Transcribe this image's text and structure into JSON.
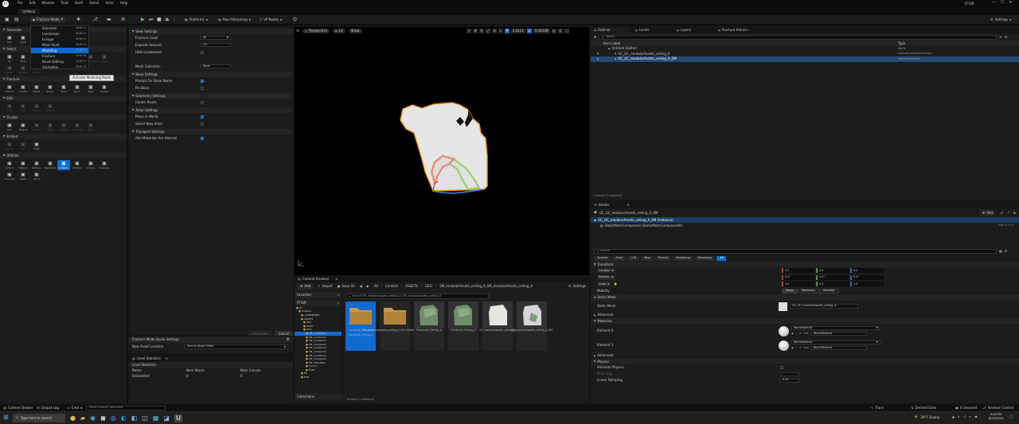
{
  "app": {
    "title": "UnMech",
    "project_name": "FFGIR",
    "menu": [
      "File",
      "Edit",
      "Window",
      "Tools",
      "Build",
      "Select",
      "Actor",
      "Help"
    ]
  },
  "toolbar": {
    "mode_label": "Fracture Mode",
    "platforms": "Platforms",
    "pixel_streaming": "Pixel Streaming",
    "vp_nodes": "VP Nodes",
    "settings": "Settings"
  },
  "mode_menu": {
    "items": [
      {
        "label": "Selection",
        "shortcut": "Shift+1"
      },
      {
        "label": "Landscape",
        "shortcut": "Shift+2"
      },
      {
        "label": "Foliage",
        "shortcut": "Shift+3"
      },
      {
        "label": "Mesh Paint",
        "shortcut": "Shift+4"
      },
      {
        "label": "Modeling",
        "shortcut": "Shift+5"
      },
      {
        "label": "Fracture",
        "shortcut": "Shift+6"
      },
      {
        "label": "Brush Editing",
        "shortcut": "Shift+7"
      },
      {
        "label": "Animation",
        "shortcut": "Shift+8"
      }
    ],
    "selected_index": 4,
    "tooltip": "Activate Modeling Mode"
  },
  "left_panel": {
    "sections": [
      {
        "title": "Generate",
        "tools": [
          {
            "label": "New",
            "icon": "new-icon"
          },
          {
            "label": "Reset",
            "icon": "reset-icon"
          }
        ]
      },
      {
        "title": "Select",
        "tools": [
          {
            "label": "All",
            "icon": "select-all-icon"
          },
          {
            "label": "None",
            "icon": "select-none-icon"
          },
          {
            "label": "Neighbors",
            "icon": "neighbors-icon"
          },
          {
            "label": "Parent",
            "icon": "parent-icon"
          },
          {
            "label": "Children",
            "icon": "children-icon"
          },
          {
            "label": "Siblings",
            "icon": "siblings-icon"
          },
          {
            "label": "All in Level",
            "icon": "level-icon"
          },
          {
            "label": "Invert",
            "icon": "invert-icon"
          },
          {
            "label": "Larger",
            "icon": "larger-icon"
          },
          {
            "label": "Smaller",
            "icon": "smaller-icon"
          },
          {
            "label": "Custom",
            "icon": "custom-icon"
          }
        ]
      },
      {
        "title": "Fracture",
        "tools": [
          {
            "label": "Uniform",
            "icon": "uniform-icon"
          },
          {
            "label": "Cluster",
            "icon": "cluster-icon"
          },
          {
            "label": "Radial",
            "icon": "radial-icon"
          },
          {
            "label": "Planar",
            "icon": "planar-icon"
          },
          {
            "label": "Slice",
            "icon": "slice-icon"
          },
          {
            "label": "Brick",
            "icon": "brick-icon"
          },
          {
            "label": "Mesh",
            "icon": "mesh-icon"
          },
          {
            "label": "Custom",
            "icon": "custom-icon"
          }
        ]
      },
      {
        "title": "Edit",
        "tools": [
          {
            "label": "Prune",
            "icon": "prune-icon"
          },
          {
            "label": "Hide",
            "icon": "hide-icon"
          },
          {
            "label": "Unhide",
            "icon": "unhide-icon"
          },
          {
            "label": "Validate",
            "icon": "validate-icon"
          }
        ]
      },
      {
        "title": "Cluster",
        "tools": [
          {
            "label": "Auto",
            "icon": "auto-icon"
          },
          {
            "label": "Magnet",
            "icon": "magnet-icon"
          },
          {
            "label": "Flatten",
            "icon": "flatten-icon"
          },
          {
            "label": "Cluster",
            "icon": "cluster-icon"
          },
          {
            "label": "Uncluster",
            "icon": "uncluster-icon"
          },
          {
            "label": "Cluster Up",
            "icon": "cluster-up-icon"
          },
          {
            "label": "Merge",
            "icon": "merge-icon"
          }
        ]
      },
      {
        "title": "Embed",
        "tools": [
          {
            "label": "Embed",
            "icon": "embed-icon"
          },
          {
            "label": "Auto",
            "icon": "auto-icon"
          },
          {
            "label": "Flush",
            "icon": "flush-icon"
          }
        ]
      },
      {
        "title": "Utilities",
        "tools": [
          {
            "label": "Autouv",
            "icon": "autouv-icon"
          },
          {
            "label": "Material",
            "icon": "material-icon"
          },
          {
            "label": "Remove",
            "icon": "remove-icon"
          },
          {
            "label": "Resample",
            "icon": "resample-icon"
          },
          {
            "label": "Collision",
            "icon": "collision-icon"
          },
          {
            "label": "Validate",
            "icon": "validate-icon"
          },
          {
            "label": "Convex",
            "icon": "convex-icon"
          },
          {
            "label": "Proximity",
            "icon": "proximity-icon"
          },
          {
            "label": "Tiny Geo",
            "icon": "tiny-geo-icon"
          },
          {
            "label": "Static",
            "icon": "static-icon"
          },
          {
            "label": "Set Ini",
            "icon": "set-init-icon"
          }
        ]
      }
    ]
  },
  "settings_panel": {
    "sections": [
      {
        "title": "View Settings",
        "rows": [
          {
            "label": "Fracture Level",
            "value": "All",
            "type": "select"
          },
          {
            "label": "Explode Amount",
            "value": "0.0",
            "type": "input"
          },
          {
            "label": "Hide Unselected",
            "value": "",
            "type": "checkbox",
            "checked": false
          },
          {
            "label": "",
            "value": "",
            "type": "blank"
          },
          {
            "label": "Mesh Collection",
            "value": "None",
            "type": "input"
          }
        ]
      },
      {
        "title": "Bone Settings",
        "rows": [
          {
            "label": "Prompt For Bone Name",
            "value": "",
            "type": "checkbox",
            "checked": true
          },
          {
            "label": "Pin Bone",
            "value": "",
            "type": "checkbox",
            "checked": false
          }
        ]
      },
      {
        "title": "Geometry Settings",
        "rows": [
          {
            "label": "Center Pivots",
            "value": "",
            "type": "checkbox",
            "checked": false
          }
        ]
      },
      {
        "title": "Actor Settings",
        "rows": [
          {
            "label": "Place in World",
            "value": "",
            "type": "checkbox",
            "checked": true
          },
          {
            "label": "Select New Actor",
            "value": "",
            "type": "checkbox",
            "checked": false
          }
        ]
      },
      {
        "title": "Transport Settings",
        "rows": [
          {
            "label": "Add Materials Are Internal",
            "value": "",
            "type": "checkbox",
            "checked": true
          }
        ]
      }
    ],
    "footer_buttons": [
      "Generate",
      "Cancel"
    ],
    "quick_settings_title": "Fracture Mode Quick Settings",
    "new_asset_location_label": "New Asset Location",
    "new_asset_location_value": "Source Asset Folder"
  },
  "level_stats": {
    "title": "Level Statistics",
    "section": "Level Statistics",
    "columns": [
      "Name",
      "Num Bones",
      "Num Convex"
    ],
    "rows": [
      [
        "Embedded",
        "0",
        "0"
      ]
    ]
  },
  "viewport": {
    "perspective": "Perspective",
    "lit": "Lit",
    "show": "Show",
    "grid_snap": "2.0121",
    "rot_snap": "0.00128",
    "fov": "1"
  },
  "content_browser": {
    "title": "Content Browser",
    "add": "Add",
    "import": "Import",
    "save_all": "Save All",
    "breadcrumb": [
      "All",
      "Content",
      "ASSETS",
      "GEO",
      "SM_modularAssets_ceiling_A_SM_modularAssets_ceiling_A"
    ],
    "settings": "Settings",
    "favorites": "Favorites",
    "project": "FFGIR",
    "tree": [
      "All",
      "Content",
      "_GENERATED",
      "ASSETS",
      "MAT",
      "SHAR",
      "GEO",
      "SM_modularAs",
      "SM_modularAs",
      "SM_modularAs",
      "SM_modularAs",
      "SM_modularAs",
      "SM_modularAs",
      "SM_modularAs",
      "SM_modularAs",
      "SM_statueBas",
      "Lumino",
      "BAKT",
      "BP",
      "POD"
    ],
    "search_placeholder": "Search SM_modularAssets_ceiling_A_SM_modularAssets_ceiling_A",
    "assets": [
      {
        "name": "Fractured_Ceiling_A",
        "name2": "Fractured_Ceiling_A",
        "kind": "folder",
        "selected": true
      },
      {
        "name": "GC_modularAssets_ceiling_A_GC_modularAssets...",
        "name2": "",
        "kind": "folder",
        "selected": false
      },
      {
        "name": "Fractured_Ceiling_A",
        "name2": "",
        "kind": "green",
        "selected": false
      },
      {
        "name": "Fractured_Ceiling_A",
        "name2": "",
        "kind": "green",
        "selected": false
      },
      {
        "name": "GC_modularAssets_ceiling_A",
        "name2": "",
        "kind": "white",
        "selected": false
      },
      {
        "name": "SM_modularAssets_ceiling_A_SM",
        "name2": "",
        "kind": "white2",
        "selected": false
      }
    ],
    "collections": "Collections",
    "status": "6 items (1 selected)"
  },
  "outliner": {
    "tabs": [
      "Outliner",
      "Levels",
      "Layers",
      "Fracture Hierarc..."
    ],
    "search_placeholder": "Search",
    "columns": [
      "Item Label",
      "Type"
    ],
    "rows": [
      {
        "label": "Untitled (Editor)",
        "type": "World",
        "indent": 0
      },
      {
        "label": "GC_GC_modularAssets_ceiling_A",
        "type": "GeometryCollectionActor",
        "indent": 1
      },
      {
        "label": "GC_GC_modularAssets_ceiling_A_SM",
        "type": "StaticMeshActor",
        "indent": 1,
        "selected": true
      }
    ],
    "footer": "2 actors (1 selected)"
  },
  "details": {
    "tab": "Details",
    "actor_name": "GC_GC_modularAssets_ceiling_A_SM",
    "add": "Add",
    "instance_label": "GC_GC_modularAssets_ceiling_A_SM (Instance)",
    "component": "StaticMeshComponent (StaticMeshComponent0)",
    "edit_in_cpp": "Edit in C++",
    "search_placeholder": "Search",
    "filter_tabs": [
      "General",
      "Actor",
      "LOD",
      "Misc",
      "Physics",
      "Rendering",
      "Streaming",
      "All"
    ],
    "transform": {
      "title": "Transform",
      "location_label": "Location",
      "location": [
        "0.0",
        "0.0",
        "0.0"
      ],
      "rotation_label": "Rotation",
      "rotation": [
        "0.0°",
        "0.0°",
        "0.0°"
      ],
      "scale_label": "Scale",
      "scale": [
        "1.0",
        "1.0",
        "1.0"
      ],
      "mobility_label": "Mobility",
      "mobility": [
        "Static",
        "Stationary",
        "Movable"
      ]
    },
    "static_mesh": {
      "title": "Static Mesh",
      "label": "Static Mesh",
      "value": "GC_GC_modularAssets_ceiling_A..."
    },
    "advanced": "Advanced",
    "materials": {
      "title": "Materials",
      "elements": [
        {
          "label": "Element 0",
          "value": "WorldMaterial",
          "use": "Use",
          "sub": "WorldMaterial"
        },
        {
          "label": "Element 1",
          "value": "WorldMaterial",
          "use": "Use",
          "sub": "WorldMaterial"
        }
      ]
    },
    "physics": {
      "title": "Physics",
      "simulate": "Simulate Physics",
      "mass": "Mass (kg)",
      "linear_damping": "Linear Damping",
      "linear_value": "0.01"
    }
  },
  "statusbar": {
    "content_drawer": "Content Drawer",
    "output_log": "Output Log",
    "cmd": "Cmd",
    "console_placeholder": "Enter Console Command",
    "trace": "Trace",
    "derived_data": "Derived Data",
    "unsaved": "4 Unsaved",
    "revision": "Revision Control"
  },
  "taskbar": {
    "search": "Type here to search",
    "weather": "26°C  Sunny",
    "time": "3:46 PM",
    "date": "8/25/2024"
  },
  "colors": {
    "accent": "#0f6ad1",
    "selection_orange": "#f09a16"
  }
}
